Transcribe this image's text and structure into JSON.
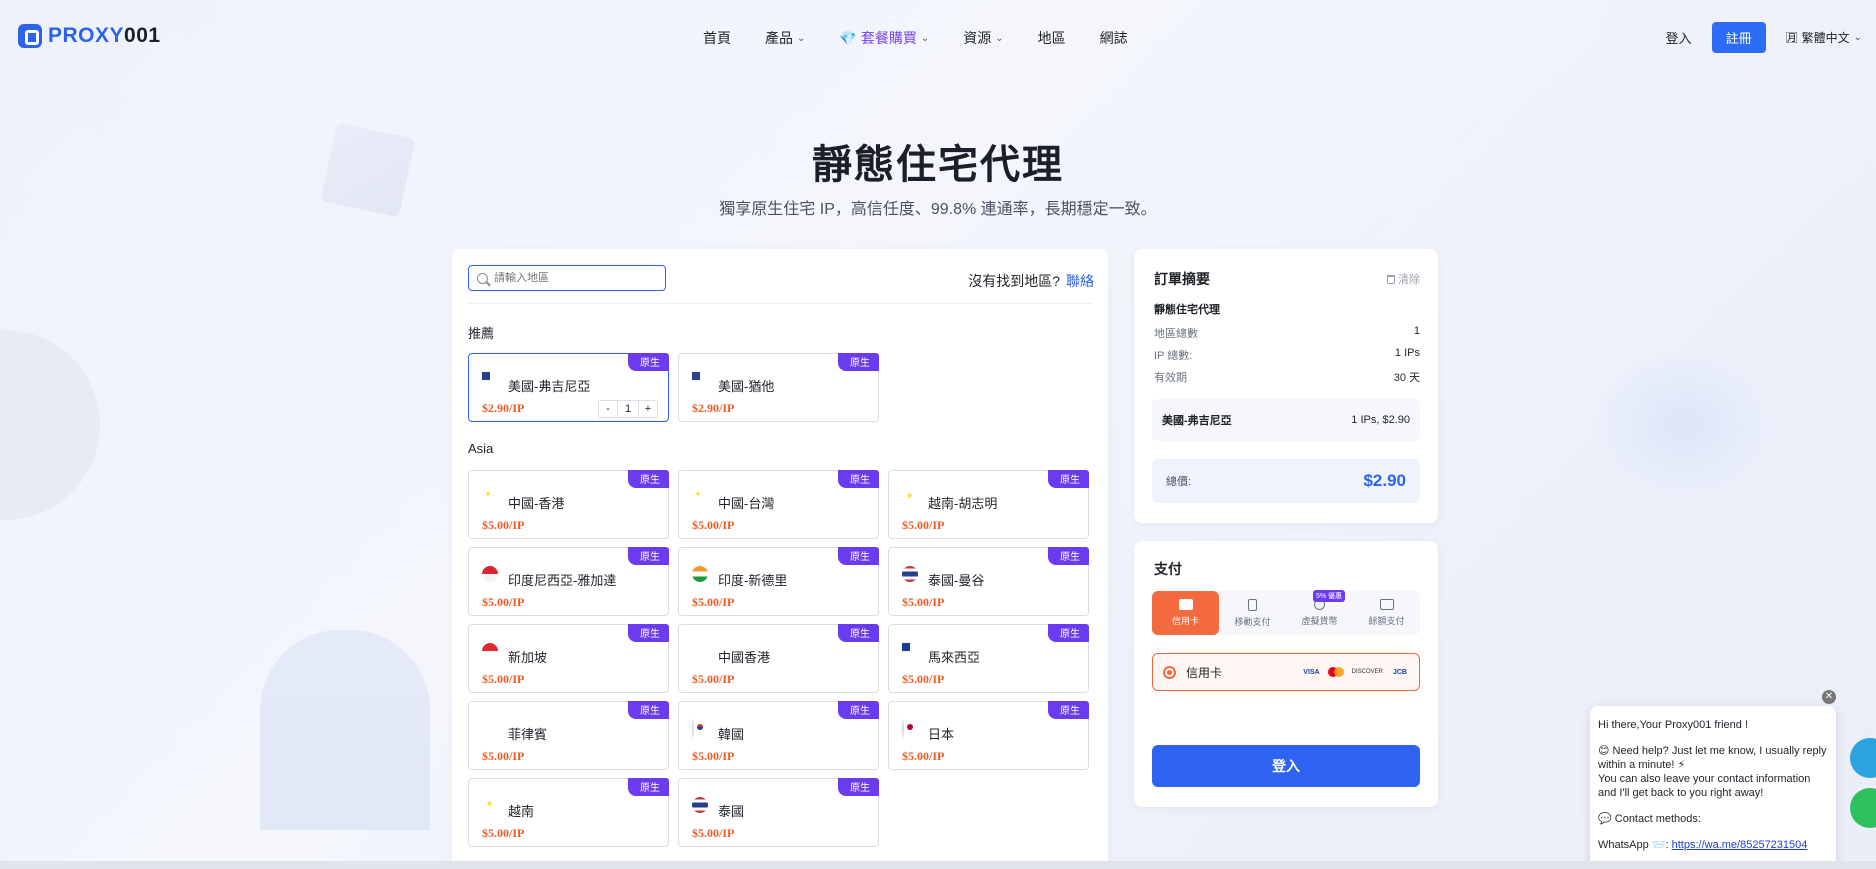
{
  "nav": {
    "logo_blue": "PROXY",
    "logo_dark": "001",
    "menu": [
      {
        "label": "首頁",
        "dropdown": false
      },
      {
        "label": "產品",
        "dropdown": true
      },
      {
        "label": "套餐購買",
        "dropdown": true
      },
      {
        "label": "資源",
        "dropdown": true
      },
      {
        "label": "地區",
        "dropdown": false
      },
      {
        "label": "網誌",
        "dropdown": false
      }
    ],
    "login": "登入",
    "register": "註冊",
    "language": "繁體中文"
  },
  "hero": {
    "title": "靜態住宅代理",
    "subtitle": "獨享原生住宅 IP，高信任度、99.8% 連通率，長期穩定一致。"
  },
  "regions": {
    "search_placeholder": "請輸入地區",
    "not_found": "沒有找到地區?",
    "contact": "聯絡",
    "recommended_title": "推薦",
    "asia_title": "Asia",
    "badge": "原生",
    "recommended": [
      {
        "name": "美國-弗吉尼亞",
        "price": "$2.90/IP",
        "flag": "us",
        "qty": "1"
      },
      {
        "name": "美國-猶他",
        "price": "$2.90/IP",
        "flag": "us"
      }
    ],
    "asia": [
      {
        "name": "中國-香港",
        "price": "$5.00/IP",
        "flag": "cn"
      },
      {
        "name": "中國-台灣",
        "price": "$5.00/IP",
        "flag": "cn"
      },
      {
        "name": "越南-胡志明",
        "price": "$5.00/IP",
        "flag": "vn"
      },
      {
        "name": "印度尼西亞-雅加達",
        "price": "$5.00/IP",
        "flag": "id"
      },
      {
        "name": "印度-新德里",
        "price": "$5.00/IP",
        "flag": "in"
      },
      {
        "name": "泰國-曼谷",
        "price": "$5.00/IP",
        "flag": "th"
      },
      {
        "name": "新加坡",
        "price": "$5.00/IP",
        "flag": "sg"
      },
      {
        "name": "中國香港",
        "price": "$5.00/IP",
        "flag": "hk"
      },
      {
        "name": "馬來西亞",
        "price": "$5.00/IP",
        "flag": "my"
      },
      {
        "name": "菲律賓",
        "price": "$5.00/IP",
        "flag": "ph"
      },
      {
        "name": "韓國",
        "price": "$5.00/IP",
        "flag": "kr"
      },
      {
        "name": "日本",
        "price": "$5.00/IP",
        "flag": "jp"
      },
      {
        "name": "越南",
        "price": "$5.00/IP",
        "flag": "vn"
      },
      {
        "name": "泰國",
        "price": "$5.00/IP",
        "flag": "th"
      }
    ]
  },
  "summary": {
    "title": "訂單摘要",
    "clear": "清除",
    "product": "靜態住宅代理",
    "rows": [
      {
        "label": "地區總數",
        "value": "1"
      },
      {
        "label": "IP 總數:",
        "value": "1 IPs"
      },
      {
        "label": "有效期",
        "value": "30 天"
      }
    ],
    "item_name": "美國-弗吉尼亞",
    "item_detail": "1 IPs, $2.90",
    "total_label": "總價:",
    "total_value": "$2.90"
  },
  "payment": {
    "title": "支付",
    "tabs": [
      {
        "label": "信用卡",
        "icon": "credit-card-icon"
      },
      {
        "label": "移動支付",
        "icon": "mobile-icon"
      },
      {
        "label": "虛擬貨幣",
        "icon": "crypto-icon"
      },
      {
        "label": "餘額支付",
        "icon": "wallet-icon"
      }
    ],
    "discount_badge": "5% 優惠",
    "method": "信用卡",
    "card_brands": [
      "VISA",
      "DISCOVER",
      "JCB"
    ],
    "login_button": "登入"
  },
  "chat": {
    "greeting": "Hi there,Your Proxy001 friend !",
    "help": "😊 Need help? Just let me know, I usually reply within a minute! ⚡",
    "leave": "You can also leave your contact information and I'll get back to you right away!",
    "methods": "💬 Contact methods:",
    "whatsapp_label": "WhatsApp 📨:",
    "whatsapp_link": "https://wa.me/85257231504"
  },
  "colors": {
    "accent": "#2d63e6",
    "badge": "#6b3bf0",
    "price": "#ee5a24",
    "pay_active": "#f26a3d"
  }
}
